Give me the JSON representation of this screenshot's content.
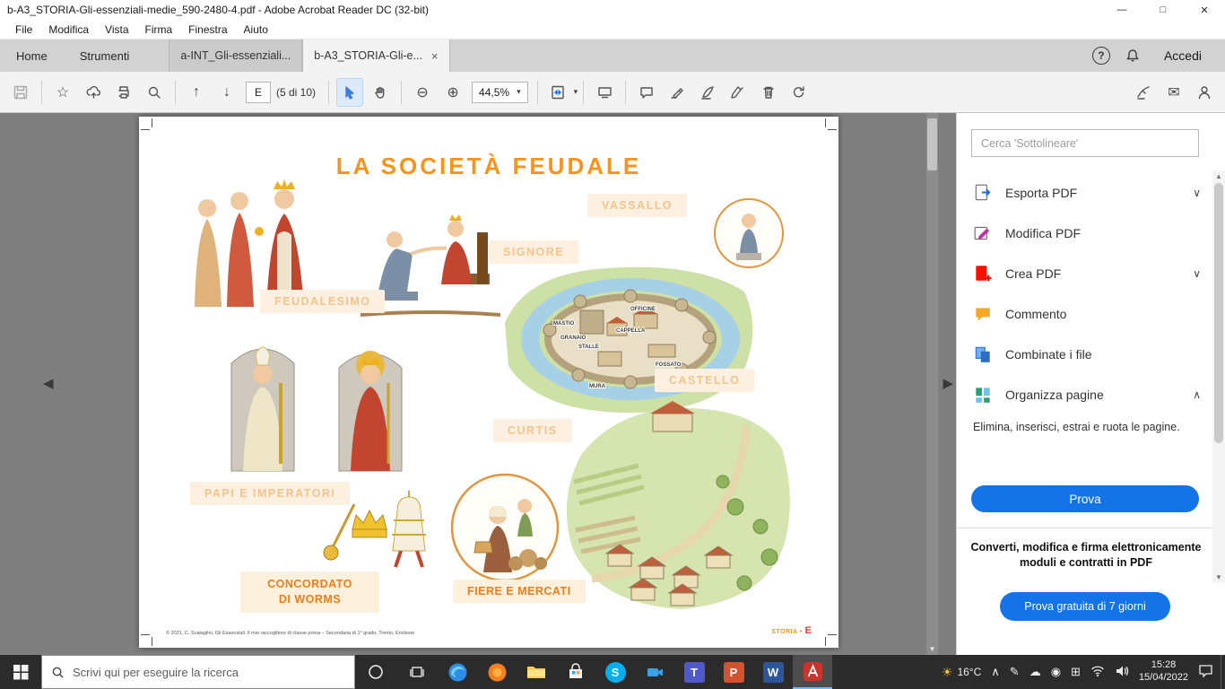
{
  "icons": {
    "minimize": "—",
    "maximize": "□",
    "window_close": "✕",
    "tab_close": "×",
    "help": "?",
    "star": "☆",
    "arrow_up": "↑",
    "arrow_down": "↓",
    "zoom_out": "⊖",
    "zoom_in": "⊕",
    "caret_down": "▾",
    "chevron_down": "∨",
    "chevron_up": "∧",
    "mail": "✉",
    "nav_left": "◀",
    "nav_right": "▶",
    "scroll_up": "▲",
    "scroll_down": "▼",
    "sun": "☀",
    "pen": "✎",
    "cloud": "☁",
    "grid": "⊞",
    "dot": "◉"
  },
  "colors": {
    "accent_blue": "#1473e6",
    "title_orange": "#f7941d",
    "strong_orange": "#ef7d1a",
    "acrobat_red": "#e8281e"
  },
  "window": {
    "title": "b-A3_STORIA-Gli-essenziali-medie_590-2480-4.pdf - Adobe Acrobat Reader DC (32-bit)"
  },
  "menubar": {
    "items": [
      {
        "label": "File"
      },
      {
        "label": "Modifica"
      },
      {
        "label": "Vista"
      },
      {
        "label": "Firma"
      },
      {
        "label": "Finestra"
      },
      {
        "label": "Aiuto"
      }
    ]
  },
  "tabbar": {
    "home": "Home",
    "tools": "Strumenti",
    "doc_tab_1": "a-INT_Gli-essenziali...",
    "doc_tab_2": "b-A3_STORIA-Gli-e...",
    "accedi": "Accedi"
  },
  "toolbar": {
    "page_letter": "E",
    "page_count": "(5 di 10)",
    "zoom_value": "44,5%"
  },
  "poster": {
    "title": "LA SOCIETÀ FEUDALE",
    "labels": {
      "feudalesimo": "FEUDALESIMO",
      "vassallo": "VASSALLO",
      "signore": "SIGNORE",
      "castello": "CASTELLO",
      "curtis": "CURTIS",
      "papi": "PAPI E IMPERATORI",
      "concordato_1": "CONCORDATO",
      "concordato_2": "DI WORMS",
      "fiere": "FIERE E MERCATI"
    },
    "castle": {
      "mastio": "MASTIO",
      "granaio": "GRANAIO",
      "stalle": "STALLE",
      "cappella": "CAPPELLA",
      "officine": "OFFICINE",
      "fossato": "FOSSATO",
      "mura": "MURA"
    },
    "footer": "© 2021, C. Scataglini, Gli Essenziali. Il mio raccoglitore di classe prima – Secondaria di 1° grado, Trento, Erickson",
    "page_code_label": "STORIA •",
    "page_code_letter": "E"
  },
  "panel": {
    "search_placeholder": "Cerca 'Sottolineare'",
    "tools": [
      {
        "label": "Esporta PDF",
        "chevron": "∨"
      },
      {
        "label": "Modifica PDF",
        "chevron": ""
      },
      {
        "label": "Crea PDF",
        "chevron": "∨"
      },
      {
        "label": "Commento",
        "chevron": ""
      },
      {
        "label": "Combinate i file",
        "chevron": ""
      },
      {
        "label": "Organizza pagine",
        "chevron": "∧"
      }
    ],
    "organizza_description": "Elimina, inserisci, estrai e ruota le pagine.",
    "prova_label": "Prova",
    "promo_text": "Converti, modifica e firma elettronicamente moduli e contratti in PDF",
    "trial_label": "Prova gratuita di 7 giorni"
  },
  "taskbar": {
    "search_placeholder": "Scrivi qui per eseguire la ricerca",
    "weather_temp": "16°C",
    "clock_time": "15:28",
    "clock_date": "15/04/2022",
    "app_letters": {
      "skype": "S",
      "teams": "T",
      "powerpoint": "P",
      "word": "W"
    }
  }
}
